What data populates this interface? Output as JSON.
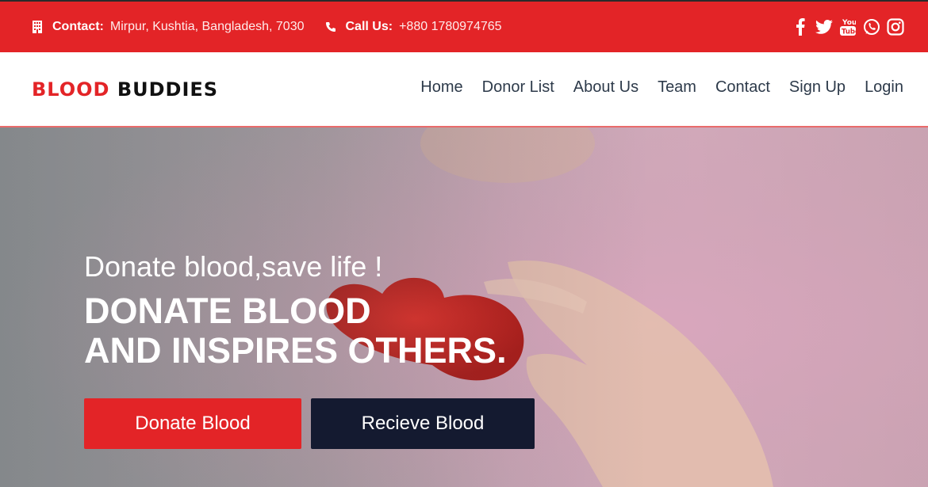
{
  "topbar": {
    "contact_label": "Contact:",
    "contact_value": "Mirpur, Kushtia, Bangladesh, 7030",
    "call_label": "Call Us:",
    "call_value": "+880 1780974765",
    "socials": [
      "facebook-icon",
      "twitter-icon",
      "youtube-icon",
      "whatsapp-icon",
      "instagram-icon"
    ]
  },
  "brand": {
    "part1": "BLOOD",
    "part2": "BUDDIES"
  },
  "nav": {
    "items": [
      "Home",
      "Donor List",
      "About Us",
      "Team",
      "Contact",
      "Sign Up",
      "Login"
    ]
  },
  "hero": {
    "tagline": "Donate blood,save life !",
    "headline_line1": "DONATE BLOOD",
    "headline_line2": "AND INSPIRES OTHERS.",
    "donate_button": "Donate Blood",
    "receive_button": "Recieve Blood"
  },
  "colors": {
    "accent": "#e32427",
    "dark": "#141a30"
  }
}
